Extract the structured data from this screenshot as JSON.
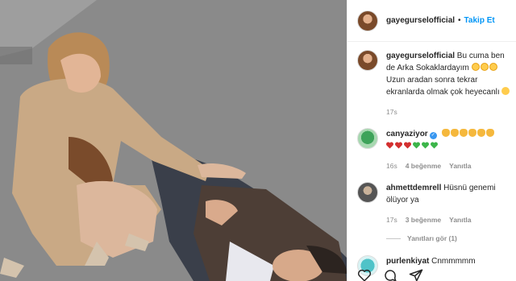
{
  "post": {
    "author": "gayegurselofficial",
    "follow_label": "Takip Et",
    "separator": "•",
    "caption_author": "gayegurselofficial",
    "caption_text_1": " Bu cuma ben de Arka Sokaklardayım",
    "caption_text_2": " Uzun aradan sonra tekrar ekranlarda olmak çok heyecanlı",
    "caption_time": "17s"
  },
  "comments": [
    {
      "user": "canyaziyor",
      "verified": true,
      "emojis": [
        "clap",
        "clap",
        "clap",
        "clap",
        "clap",
        "clap"
      ],
      "hearts": [
        "#d32f2f",
        "#d32f2f",
        "#d32f2f",
        "#3cb54a",
        "#3cb54a",
        "#3cb54a"
      ],
      "time": "16s",
      "likes": "4 beğenme",
      "reply": "Yanıtla"
    },
    {
      "user": "ahmettdemrell",
      "text": " Hüsnü genemi ölüyor ya",
      "time": "17s",
      "likes": "3 beğenme",
      "reply": "Yanıtla",
      "view_replies": "Yanıtları gör (1)"
    },
    {
      "user": "purlenkiyat",
      "text": " Cnmmmmm"
    }
  ],
  "icons": [
    "heart-icon",
    "comment-icon",
    "share-icon"
  ]
}
